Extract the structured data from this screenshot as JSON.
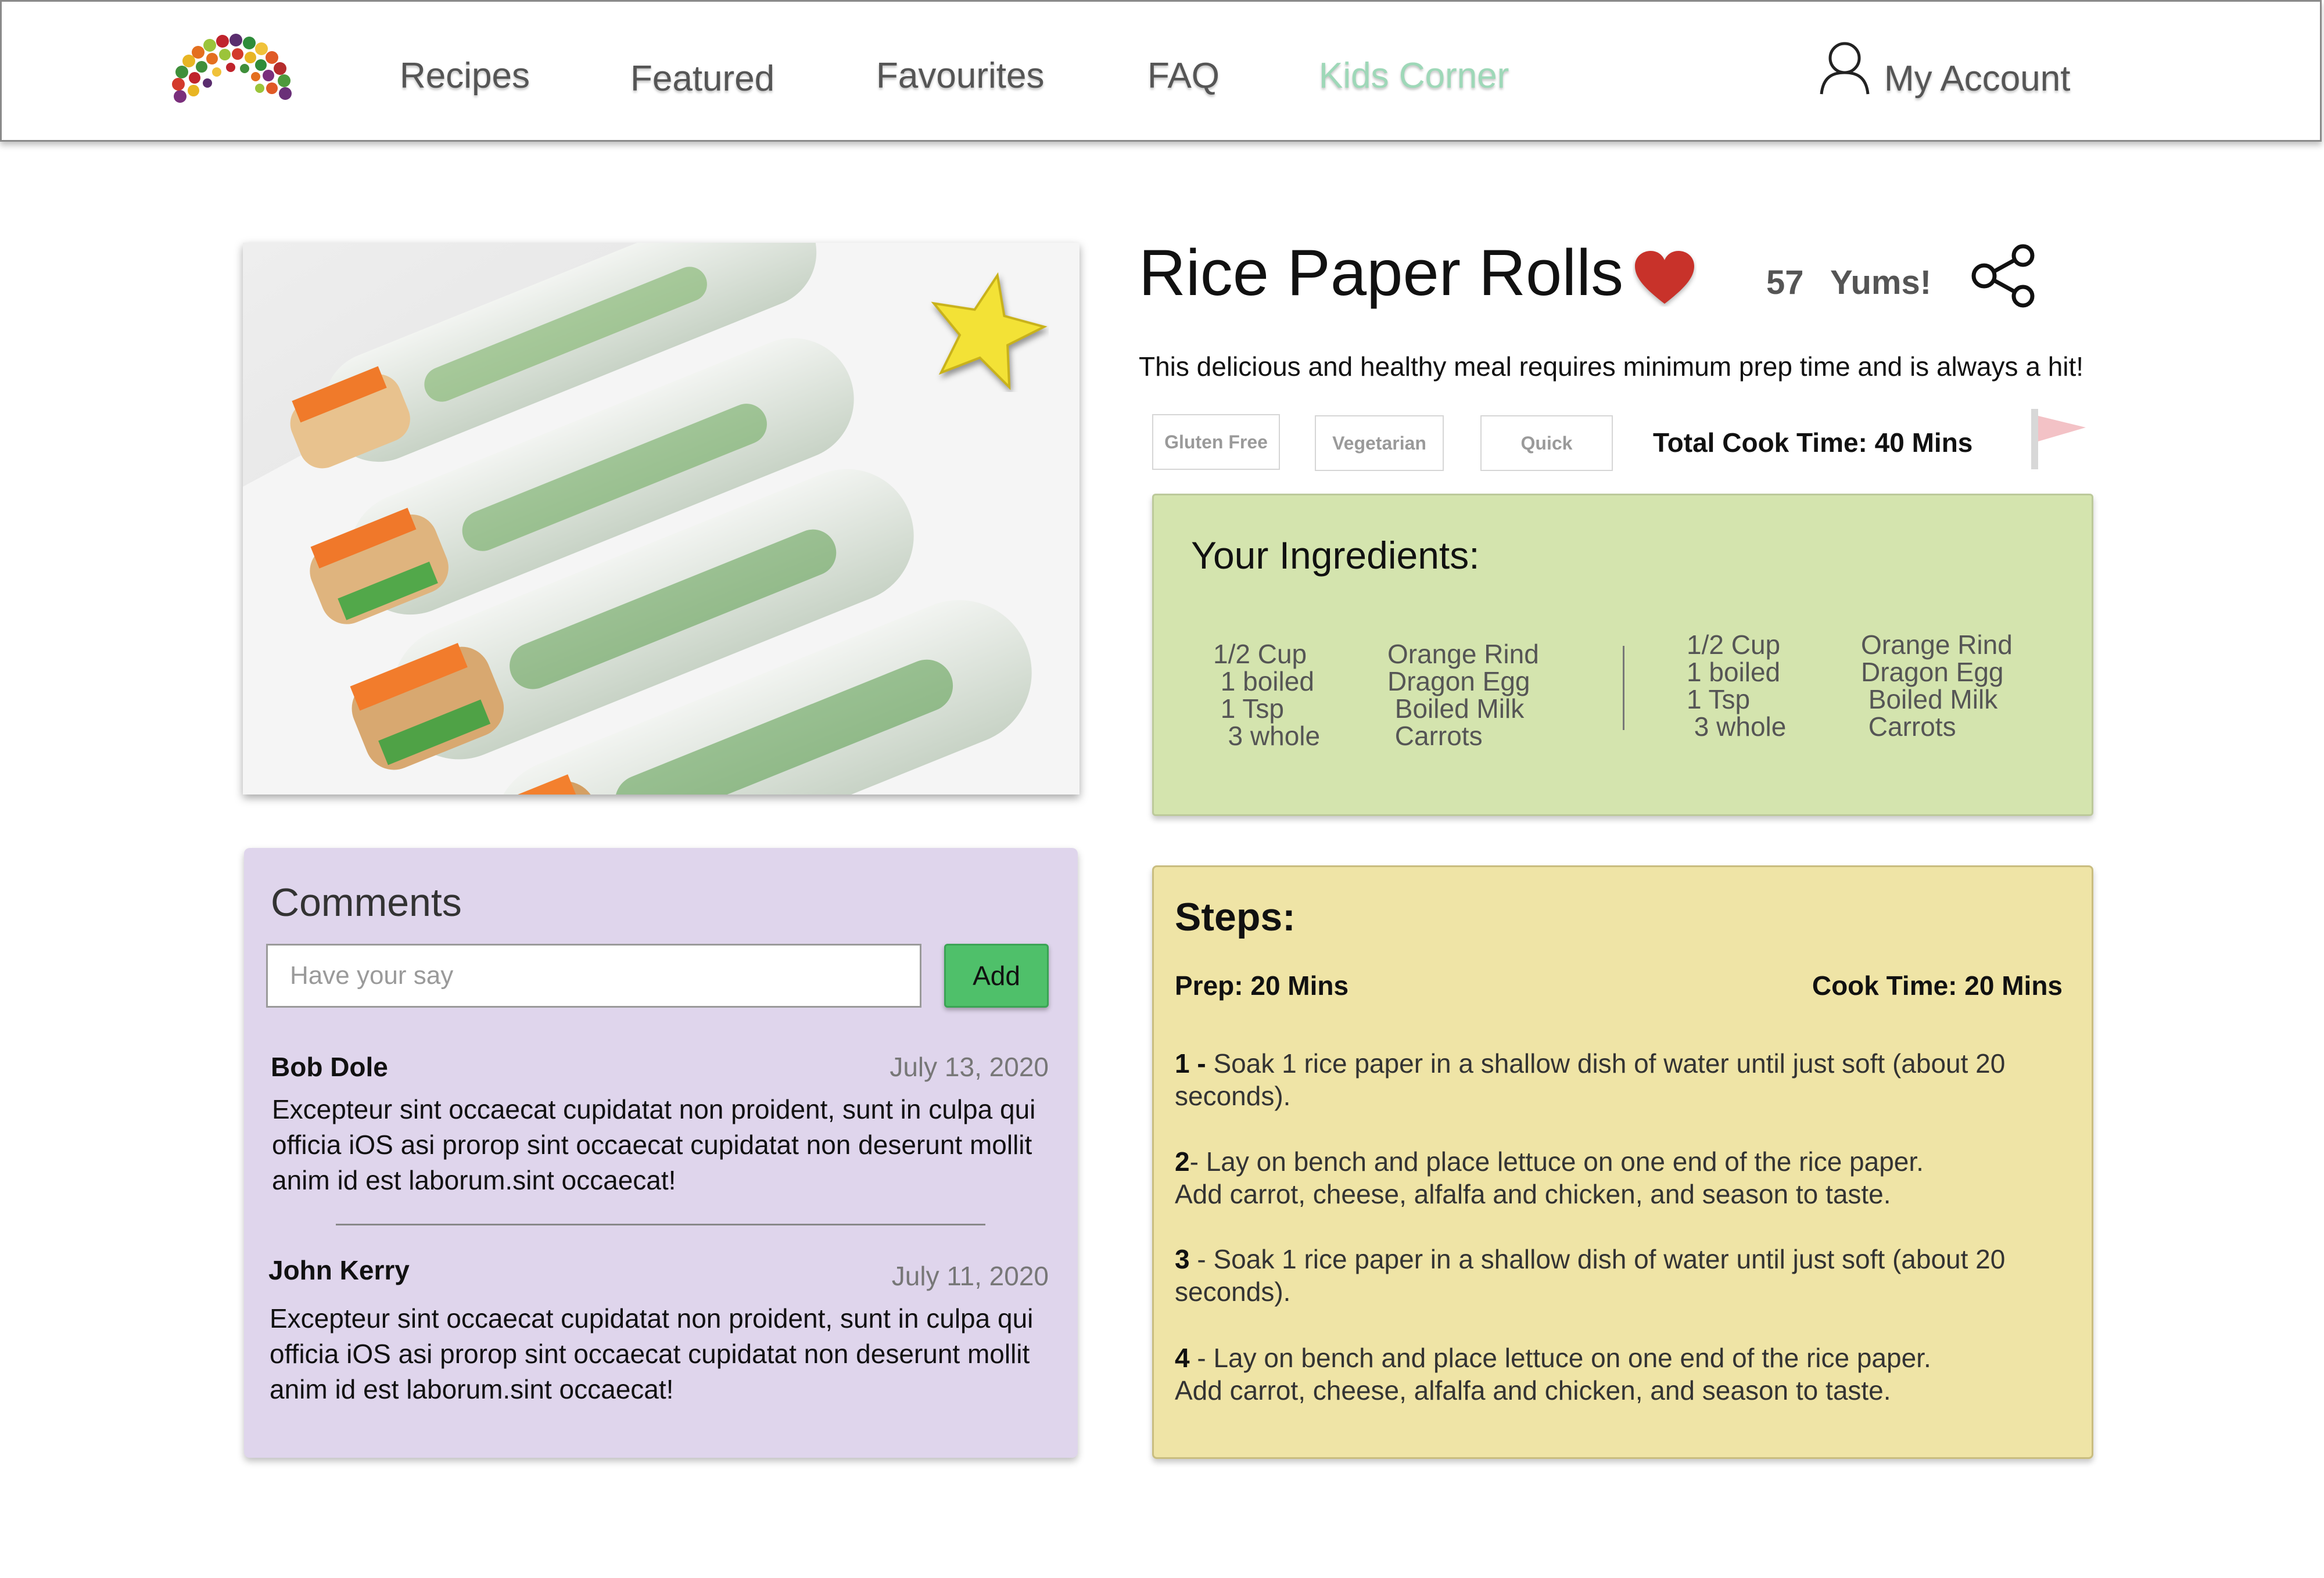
{
  "header": {
    "logo_icon": "fruit-rainbow-logo",
    "nav": {
      "recipes": "Recipes",
      "featured": "Featured",
      "favourites": "Favourites",
      "faq": "FAQ",
      "kids_corner": "Kids Corner"
    },
    "account_icon": "user-icon",
    "account_label": "My Account",
    "active_color": "#9ed8b8"
  },
  "recipe": {
    "image": "rice-paper-rolls-photo",
    "featured_icon": "star-icon",
    "title": "Rice Paper Rolls",
    "favourite_icon": "heart-icon",
    "yum_count": "57",
    "yum_label": "Yums!",
    "share_icon": "share-icon",
    "description": "This delicious and healthy meal requires minimum prep time and is always a hit!",
    "tags": [
      "Gluten Free",
      "Vegetarian",
      "Quick"
    ],
    "total_cook_time": "Total Cook Time: 40 Mins",
    "flag_icon": "flag-icon"
  },
  "ingredients": {
    "title": "Your Ingredients:",
    "columns": [
      {
        "quantities": "1/2 Cup\n 1 boiled\n 1 Tsp\n  3 whole",
        "items": "Orange Rind\nDragon Egg\n Boiled Milk\n Carrots"
      },
      {
        "quantities": "1/2 Cup\n1 boiled\n1 Tsp\n 3 whole",
        "items": "Orange Rind\nDragon Egg\n Boiled Milk\n Carrots"
      }
    ]
  },
  "comments": {
    "title": "Comments",
    "input_placeholder": "Have your say",
    "add_label": "Add",
    "items": [
      {
        "author": "Bob Dole",
        "date": "July 13, 2020",
        "body": "Excepteur sint occaecat cupidatat non proident, sunt in culpa qui officia iOS asi prorop sint occaecat cupidatat non deserunt mollit anim id est laborum.sint occaecat!"
      },
      {
        "author": "John Kerry",
        "date": "July 11, 2020",
        "body": "Excepteur sint occaecat cupidatat non proident, sunt in culpa qui officia iOS asi prorop sint occaecat cupidatat non deserunt mollit anim id est laborum.sint occaecat!"
      }
    ]
  },
  "steps": {
    "title": "Steps:",
    "prep": "Prep: 20 Mins",
    "cook": "Cook Time: 20 Mins",
    "items": [
      {
        "num": "1 -",
        "text": " Soak 1 rice paper in a shallow dish of water until just soft (about 20 seconds)."
      },
      {
        "num": "2",
        "text": "- Lay on bench and place lettuce on one end of the rice paper. Add carrot, cheese, alfalfa and chicken, and season to taste."
      },
      {
        "num": "3",
        "text": " - Soak 1 rice paper in a shallow dish of water until just soft (about 20 seconds)."
      },
      {
        "num": "4",
        "text": " - Lay on bench and place lettuce on one end of the rice paper. Add carrot, cheese, alfalfa and chicken, and season to taste."
      }
    ]
  }
}
